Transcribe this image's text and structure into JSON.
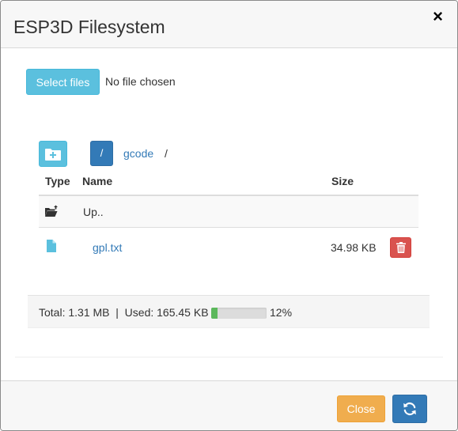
{
  "dialog": {
    "title": "ESP3D Filesystem",
    "close_glyph": "×"
  },
  "upload": {
    "select_label": "Select files",
    "status": "No file chosen"
  },
  "breadcrumb": {
    "root_label": "/",
    "folder": "gcode",
    "separator": "/"
  },
  "table": {
    "headers": {
      "type": "Type",
      "name": "Name",
      "size": "Size"
    },
    "up_row": {
      "label": "Up..",
      "icon": "folder-up-icon"
    },
    "rows": [
      {
        "name": "gpl.txt",
        "size": "34.98 KB",
        "icon": "file-icon"
      }
    ]
  },
  "storage": {
    "summary": "Total: 1.31 MB  |  Used: 165.45 KB",
    "used_percent": 12,
    "percent_label": "12%"
  },
  "footer": {
    "close_label": "Close",
    "refresh_icon": "refresh-icon"
  },
  "colors": {
    "info": "#5bc0de",
    "primary": "#337ab7",
    "danger": "#d9534f",
    "warning": "#f0ad4e",
    "success": "#5cb85c"
  }
}
